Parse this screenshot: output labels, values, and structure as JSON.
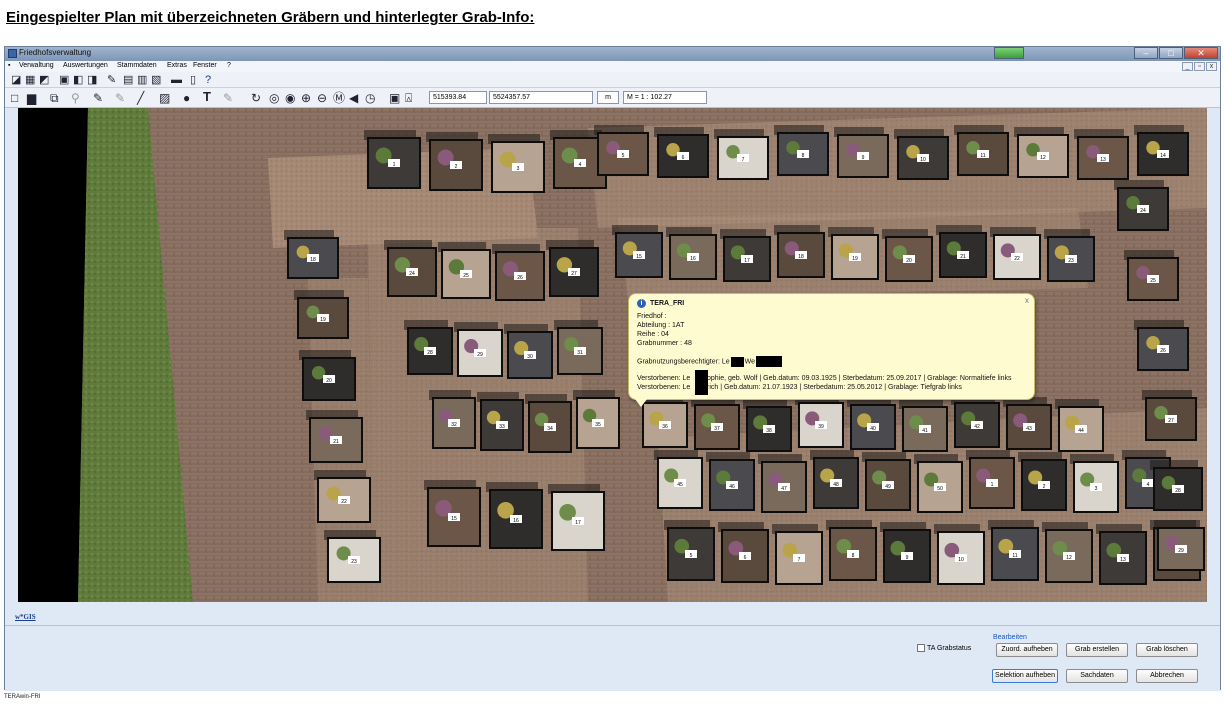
{
  "heading": "Eingespielter Plan mit überzeichneten Gräbern und hinterlegter Grab-Info:",
  "window": {
    "title": "Friedhofsverwaltung"
  },
  "menu": [
    "Verwaltung",
    "Auswertungen",
    "Stammdaten",
    "Extras",
    "Fenster",
    "?"
  ],
  "toolbar": {
    "coord_x": "515393.84",
    "coord_y": "5524357.57",
    "unit": "m",
    "scale": "M = 1 : 102.27"
  },
  "map": {
    "logo": "w*GIS",
    "grave_labels": [
      "1",
      "2",
      "3",
      "4",
      "5",
      "6",
      "7",
      "8",
      "9",
      "10",
      "11",
      "12",
      "13",
      "14",
      "15",
      "16",
      "17",
      "18",
      "19",
      "20",
      "21",
      "22",
      "23",
      "24",
      "25",
      "26",
      "27",
      "28",
      "29",
      "30",
      "31",
      "32",
      "33",
      "34",
      "35",
      "36",
      "37",
      "38",
      "39",
      "40",
      "41",
      "42",
      "43",
      "44",
      "45",
      "46",
      "47",
      "48",
      "49",
      "50"
    ]
  },
  "popup": {
    "title": "TERA_FRI",
    "friedhof": "Friedhof :",
    "abteilung": "Abteilung : 1AT",
    "reihe": "Reihe : 04",
    "grabnummer": "Grabnummer : 48",
    "berechtigter": "Grabnutzungsberechtigter: Le",
    "berechtigter_tail": "We",
    "verstorben1_a": "Verstorbenen: Le",
    "verstorben1_b": "Sophie, geb. Wolf | Geb.datum: 09.03.1925 | Sterbedatum: 25.09.2017 | Grablage: Normaltiefe links",
    "verstorben2_a": "Verstorbenen: Le",
    "verstorben2_b": "Erich | Geb.datum: 21.07.1923 | Sterbedatum: 25.05.2012 | Grablage: Tiefgrab links",
    "close": "x"
  },
  "panel": {
    "group_label": "Bearbeiten",
    "checkbox_label": "TA Grabstatus",
    "btn_zuord": "Zuord. aufheben",
    "btn_erstellen": "Grab erstellen",
    "btn_loeschen": "Grab löschen",
    "btn_selektion": "Selektion aufheben",
    "btn_sachdaten": "Sachdaten",
    "btn_abbrechen": "Abbrechen"
  },
  "status": "TERAwin-FRI"
}
